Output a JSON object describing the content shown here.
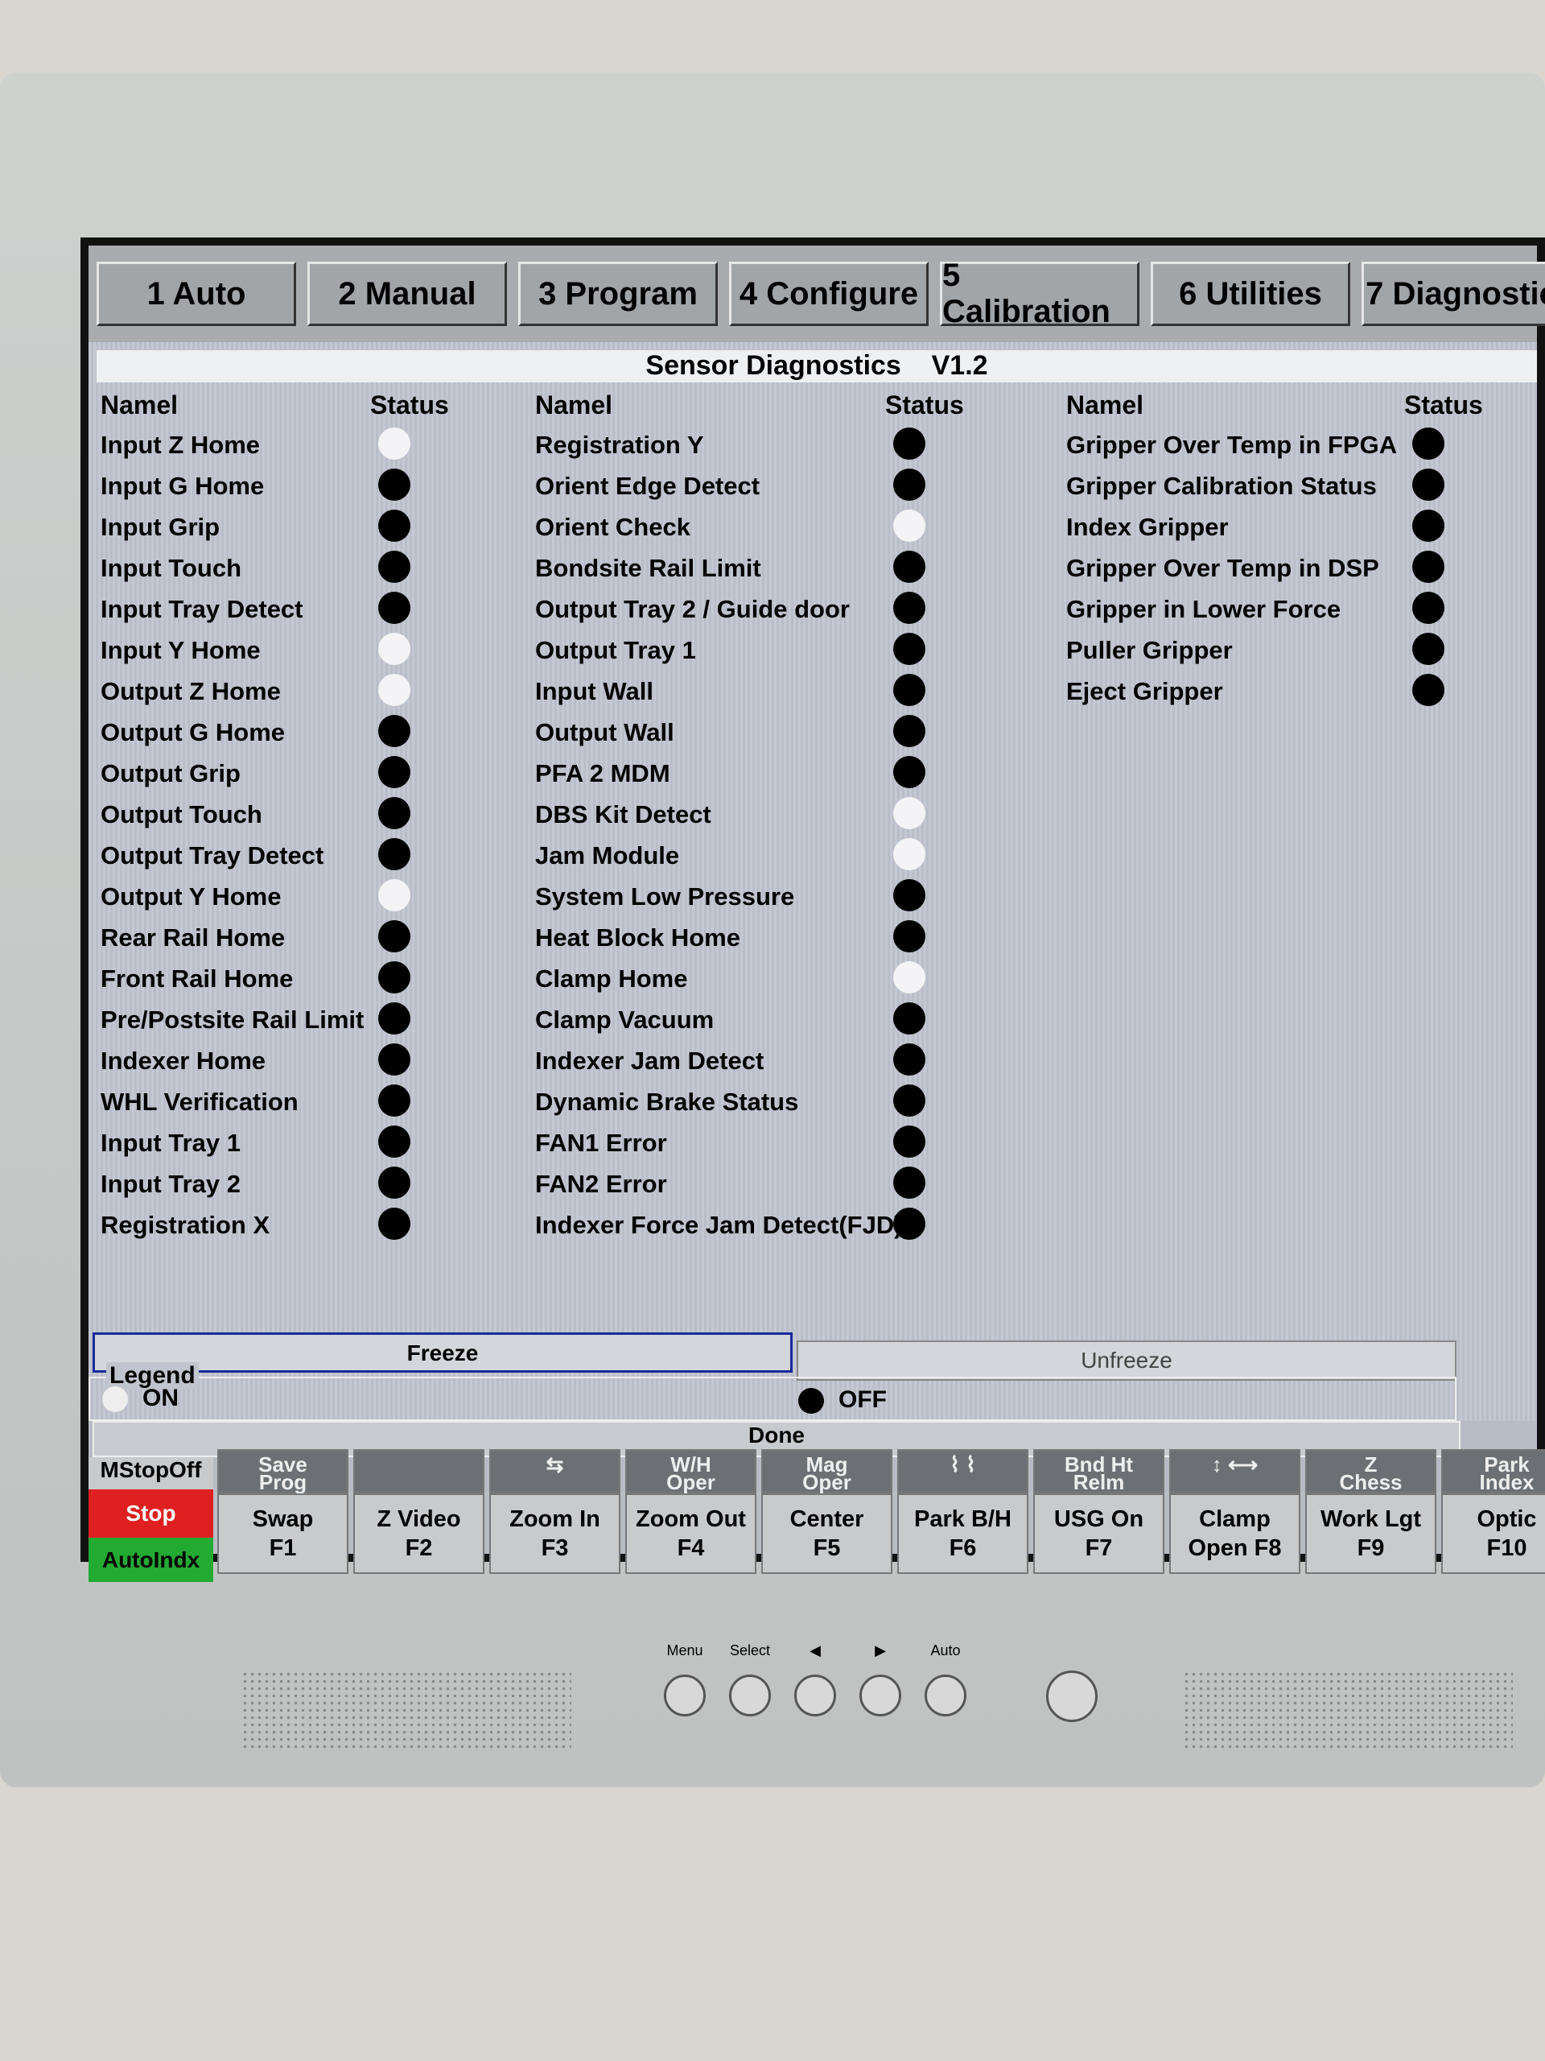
{
  "tabs": [
    "1 Auto",
    "2 Manual",
    "3 Program",
    "4 Configure",
    "5 Calibration",
    "6 Utilities",
    "7 Diagnostic"
  ],
  "title": "Sensor Diagnostics",
  "version": "V1.2",
  "headers": {
    "name": "Namel",
    "status": "Status"
  },
  "colors": {
    "on": "#ffffff",
    "off": "#000000",
    "stop": "#e02020",
    "autoindx": "#22aa33"
  },
  "columns": [
    [
      [
        "Input Z Home",
        "ON"
      ],
      [
        "Input G Home",
        "OFF"
      ],
      [
        "Input Grip",
        "OFF"
      ],
      [
        "Input Touch",
        "OFF"
      ],
      [
        "Input Tray Detect",
        "OFF"
      ],
      [
        "Input Y Home",
        "ON"
      ],
      [
        "Output Z Home",
        "ON"
      ],
      [
        "Output G Home",
        "OFF"
      ],
      [
        "Output Grip",
        "OFF"
      ],
      [
        "Output Touch",
        "OFF"
      ],
      [
        "Output Tray Detect",
        "OFF"
      ],
      [
        "Output Y Home",
        "ON"
      ],
      [
        "Rear Rail Home",
        "OFF"
      ],
      [
        "Front Rail Home",
        "OFF"
      ],
      [
        "Pre/Postsite Rail Limit",
        "OFF"
      ],
      [
        "Indexer Home",
        "OFF"
      ],
      [
        "WHL Verification",
        "OFF"
      ],
      [
        "Input Tray 1",
        "OFF"
      ],
      [
        "Input Tray 2",
        "OFF"
      ],
      [
        "Registration X",
        "OFF"
      ]
    ],
    [
      [
        "Registration Y",
        "OFF"
      ],
      [
        "Orient Edge Detect",
        "OFF"
      ],
      [
        "Orient Check",
        "ON"
      ],
      [
        "Bondsite Rail Limit",
        "OFF"
      ],
      [
        "Output Tray 2 / Guide door",
        "OFF"
      ],
      [
        "Output Tray 1",
        "OFF"
      ],
      [
        "Input Wall",
        "OFF"
      ],
      [
        "Output Wall",
        "OFF"
      ],
      [
        "PFA 2 MDM",
        "OFF"
      ],
      [
        "DBS Kit Detect",
        "ON"
      ],
      [
        "Jam Module",
        "ON"
      ],
      [
        "System Low Pressure",
        "OFF"
      ],
      [
        "Heat Block Home",
        "OFF"
      ],
      [
        "Clamp Home",
        "ON"
      ],
      [
        "Clamp Vacuum",
        "OFF"
      ],
      [
        "Indexer Jam Detect",
        "OFF"
      ],
      [
        "Dynamic Brake Status",
        "OFF"
      ],
      [
        "FAN1 Error",
        "OFF"
      ],
      [
        "FAN2 Error",
        "OFF"
      ],
      [
        "Indexer Force Jam Detect(FJD)",
        "OFF"
      ]
    ],
    [
      [
        "Gripper Over Temp in FPGA",
        "OFF"
      ],
      [
        "Gripper Calibration Status",
        "OFF"
      ],
      [
        "Index Gripper",
        "OFF"
      ],
      [
        "Gripper Over Temp in DSP",
        "OFF"
      ],
      [
        "Gripper in Lower Force",
        "OFF"
      ],
      [
        "Puller Gripper",
        "OFF"
      ],
      [
        "Eject Gripper",
        "OFF"
      ]
    ]
  ],
  "freeze": "Freeze",
  "unfreeze": "Unfreeze",
  "legend": {
    "title": "Legend",
    "on": "ON",
    "off": "OFF"
  },
  "done": "Done",
  "side": {
    "mstop": "MStopOff",
    "stop": "Stop",
    "autoindx": "AutoIndx"
  },
  "top_keys": [
    "Save\nProg",
    "",
    "⇆",
    "W/H\nOper",
    "Mag\nOper",
    "⌇ ⌇",
    "Bnd Ht\nRelm",
    "↕ ⟷",
    "Z\nChess",
    "Park\nIndex"
  ],
  "fkeys": [
    "Swap\nF1",
    "Z Video\nF2",
    "Zoom In\nF3",
    "Zoom Out\nF4",
    "Center\nF5",
    "Park B/H\nF6",
    "USG On\nF7",
    "Clamp\nOpen F8",
    "Work Lgt\nF9",
    "Optic\nF10"
  ],
  "monitor_buttons": [
    "Menu",
    "Select",
    "◀",
    "▶",
    "Auto"
  ]
}
